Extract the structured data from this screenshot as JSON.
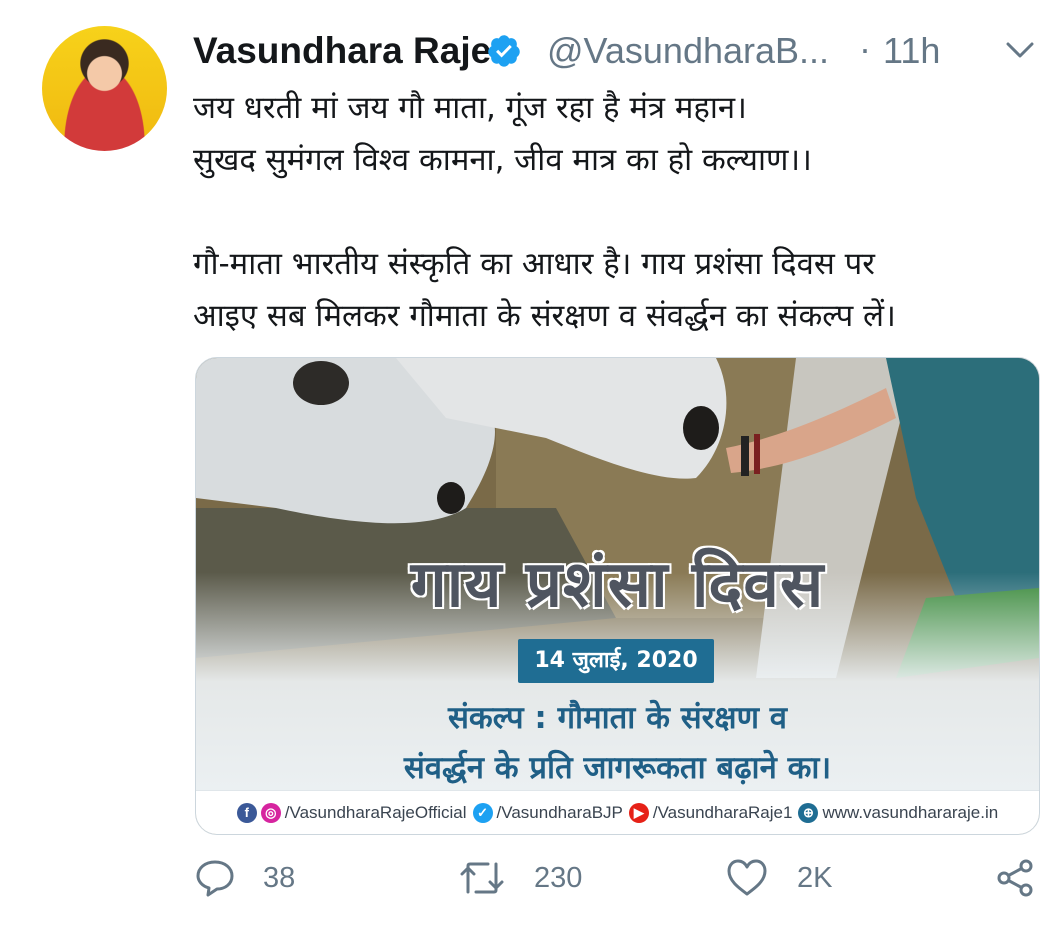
{
  "tweet": {
    "author_name": "Vasundhara Raje",
    "handle": "@VasundharaB...",
    "separator": "·",
    "time": "11h",
    "lines": [
      "जय धरती मां जय गौ माता, गूंज रहा है मंत्र महान।",
      "सुखद सुमंगल विश्व कामना, जीव मात्र का हो कल्याण।।",
      "गौ-माता भारतीय संस्कृति का आधार है। गाय प्रशंसा दिवस पर",
      "आइए सब मिलकर गौमाता के संरक्षण व संवर्द्धन का संकल्प लें।"
    ]
  },
  "media": {
    "title": "गाय प्रशंसा दिवस",
    "date": "14 जुलाई, 2020",
    "pledge_line1": "संकल्प : गौमाता के संरक्षण व",
    "pledge_line2": "संवर्द्धन के प्रति जागरूकता बढ़ाने का।",
    "footer": {
      "facebook_instagram": "/VasundharaRajeOfficial",
      "twitter": "/VasundharaBJP",
      "youtube": "/VasundharaRaje1",
      "website": "www.vasundhararaje.in"
    }
  },
  "actions": {
    "replies": "38",
    "retweets": "230",
    "likes": "2K"
  },
  "colors": {
    "verified_blue": "#1da1f2",
    "secondary_text": "#657786",
    "badge_blue": "#1f6d93",
    "pledge_blue": "#1f5f86"
  },
  "icons": [
    "verified-icon",
    "chevron-down-icon",
    "reply-icon",
    "retweet-icon",
    "like-icon",
    "share-icon",
    "facebook-icon",
    "instagram-icon",
    "twitter-icon",
    "youtube-icon",
    "globe-icon"
  ]
}
